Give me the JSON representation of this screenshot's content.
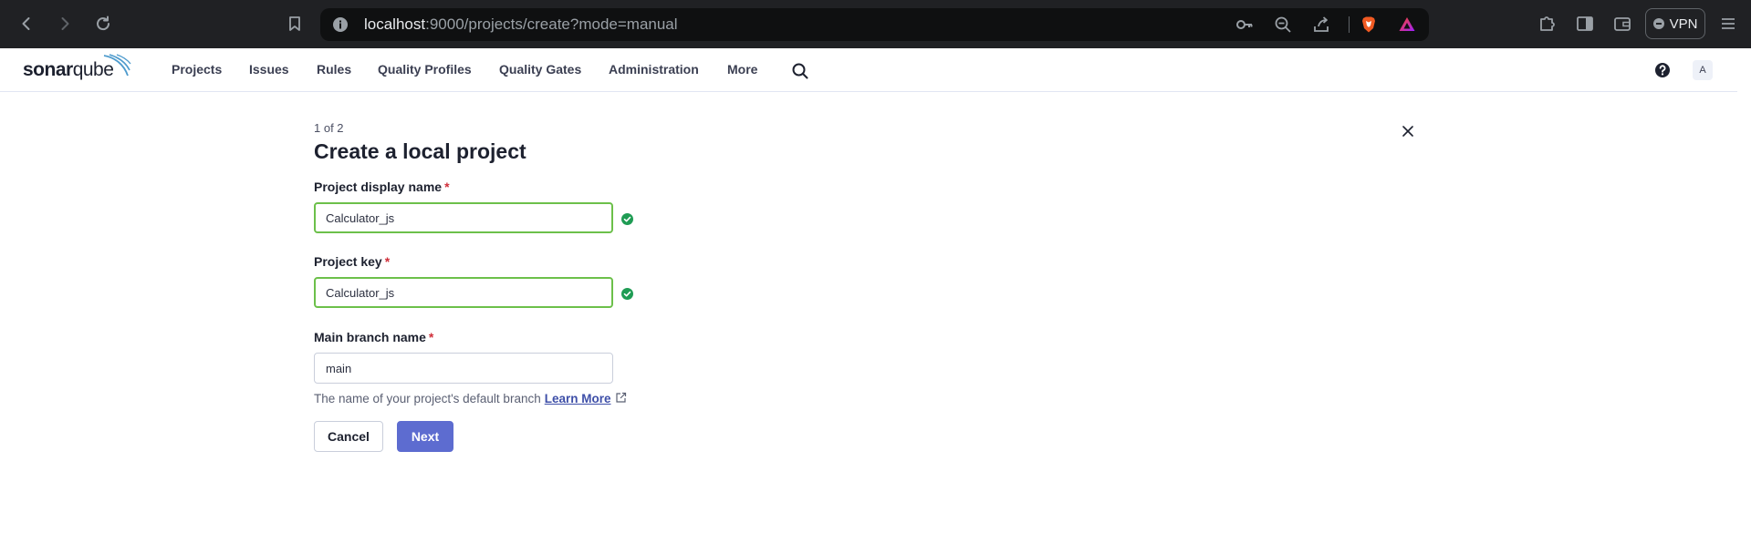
{
  "browser": {
    "url_host": "localhost",
    "url_rest": ":9000/projects/create?mode=manual",
    "vpn_label": "VPN"
  },
  "nav": {
    "logo_bold": "sonar",
    "logo_light": "qube",
    "items": [
      {
        "label": "Projects"
      },
      {
        "label": "Issues"
      },
      {
        "label": "Rules"
      },
      {
        "label": "Quality Profiles"
      },
      {
        "label": "Quality Gates"
      },
      {
        "label": "Administration"
      },
      {
        "label": "More"
      }
    ],
    "avatar_letter": "A"
  },
  "form": {
    "step": "1 of 2",
    "title": "Create a local project",
    "display_name": {
      "label": "Project display name",
      "required": "*",
      "value": "Calculator_js"
    },
    "project_key": {
      "label": "Project key",
      "required": "*",
      "value": "Calculator_js"
    },
    "branch": {
      "label": "Main branch name",
      "required": "*",
      "value": "main"
    },
    "branch_help": "The name of your project's default branch",
    "learn_more": "Learn More",
    "cancel_label": "Cancel",
    "next_label": "Next"
  },
  "colors": {
    "accent": "#5d6cd0",
    "valid": "#6cc04a",
    "valid_icon": "#1f9c54",
    "required": "#d02f3a"
  }
}
